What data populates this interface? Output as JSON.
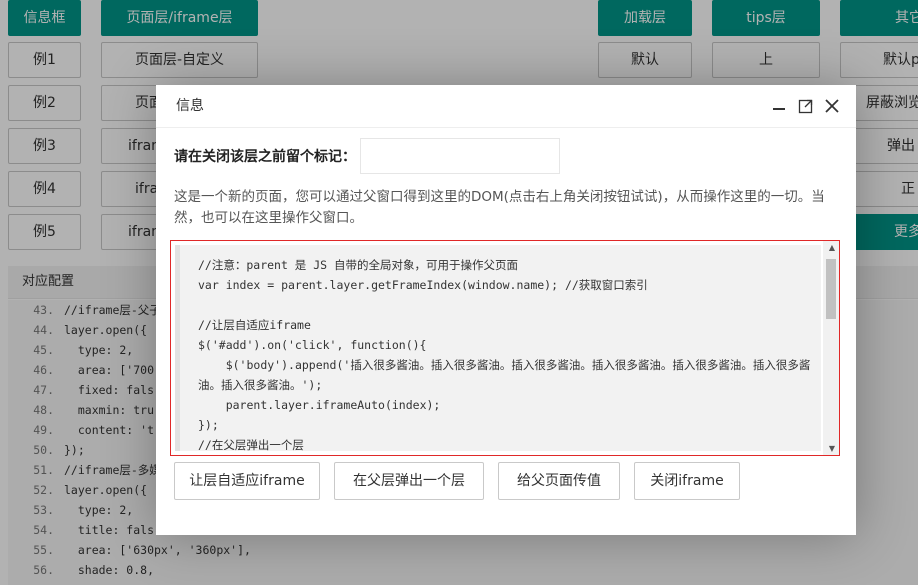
{
  "top_buttons": {
    "info_box": "信息框",
    "page_layer": "页面层/iframe层",
    "loading_layer": "加载层",
    "tips_layer": "tips层",
    "other": "其它"
  },
  "example_buttons": [
    "例1",
    "例2",
    "例3",
    "例4",
    "例5"
  ],
  "page_col": [
    "页面层-自定义",
    "页面",
    "ifram",
    "ifra",
    "ifram"
  ],
  "loading_col": [
    "默认"
  ],
  "tips_col": [
    "上"
  ],
  "other_col": [
    "默认p",
    "屏蔽浏览",
    "弹出",
    "正",
    "更多"
  ],
  "config_panel": {
    "title": "对应配置",
    "lines": [
      {
        "num": "43.",
        "text": "//iframe层-父子"
      },
      {
        "num": "44.",
        "text": "layer.open({"
      },
      {
        "num": "45.",
        "text": "  type: 2,"
      },
      {
        "num": "46.",
        "text": "  area: ['700"
      },
      {
        "num": "47.",
        "text": "  fixed: fals"
      },
      {
        "num": "48.",
        "text": "  maxmin: tru"
      },
      {
        "num": "49.",
        "text": "  content: 't"
      },
      {
        "num": "50.",
        "text": "});"
      },
      {
        "num": "51.",
        "text": "//iframe层-多媒"
      },
      {
        "num": "52.",
        "text": "layer.open({"
      },
      {
        "num": "53.",
        "text": "  type: 2,"
      },
      {
        "num": "54.",
        "text": "  title: fals"
      },
      {
        "num": "55.",
        "text": "  area: ['630px', '360px'],"
      },
      {
        "num": "56.",
        "text": "  shade: 0.8,"
      }
    ]
  },
  "layer": {
    "title": "信息",
    "mark_label": "请在关闭该层之前留个标记：",
    "mark_value": "",
    "desc": "这是一个新的页面，您可以通过父窗口得到这里的DOM(点击右上角关闭按钮试试)，从而操作这里的一切。当然，也可以在这里操作父窗口。",
    "code_lines": [
      "//注意：parent 是 JS 自带的全局对象，可用于操作父页面",
      "var index = parent.layer.getFrameIndex(window.name); //获取窗口索引",
      " ",
      "//让层自适应iframe",
      "$('#add').on('click', function(){",
      "    $('body').append('插入很多酱油。插入很多酱油。插入很多酱油。插入很多酱油。插入很多酱油。插入很多酱油。插入很多酱油。');",
      "    parent.layer.iframeAuto(index);",
      "});",
      "//在父层弹出一个层"
    ],
    "buttons": [
      "让层自适应iframe",
      "在父层弹出一个层",
      "给父页面传值",
      "关闭iframe"
    ]
  }
}
